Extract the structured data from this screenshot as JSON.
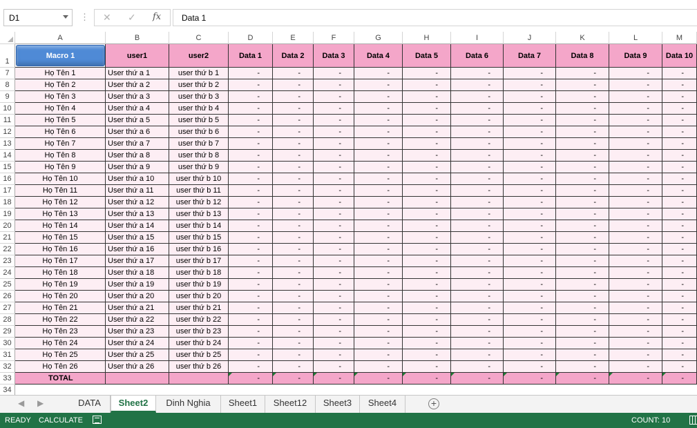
{
  "formula_bar": {
    "name_box": "D1",
    "cancel_symbol": "✕",
    "enter_symbol": "✓",
    "fx_symbol": "fx",
    "content": "Data 1"
  },
  "grid": {
    "column_letters": [
      "A",
      "B",
      "C",
      "D",
      "E",
      "F",
      "G",
      "H",
      "I",
      "J",
      "K",
      "L",
      "M"
    ],
    "header_row_number": "1",
    "headers": [
      "Macro 1",
      "user1",
      "user2",
      "Data 1",
      "Data 2",
      "Data 3",
      "Data 4",
      "Data 5",
      "Data 6",
      "Data 7",
      "Data 8",
      "Data 9",
      "Data 10"
    ],
    "rows": [
      {
        "num": "7",
        "name": "Họ Tên 1",
        "user1": "User thứ a 1",
        "user2": "user thứ b 1"
      },
      {
        "num": "8",
        "name": "Họ Tên 2",
        "user1": "User thứ a 2",
        "user2": "user thứ b 2"
      },
      {
        "num": "9",
        "name": "Họ Tên 3",
        "user1": "User thứ a 3",
        "user2": "user thứ b 3"
      },
      {
        "num": "10",
        "name": "Họ Tên 4",
        "user1": "User thứ a 4",
        "user2": "user thứ b 4"
      },
      {
        "num": "11",
        "name": "Họ Tên 5",
        "user1": "User thứ a 5",
        "user2": "user thứ b 5"
      },
      {
        "num": "12",
        "name": "Họ Tên 6",
        "user1": "User thứ a 6",
        "user2": "user thứ b 6"
      },
      {
        "num": "13",
        "name": "Họ Tên 7",
        "user1": "User thứ a 7",
        "user2": "user thứ b 7"
      },
      {
        "num": "14",
        "name": "Họ Tên 8",
        "user1": "User thứ a 8",
        "user2": "user thứ b 8"
      },
      {
        "num": "15",
        "name": "Họ Tên 9",
        "user1": "User thứ a 9",
        "user2": "user thứ b 9"
      },
      {
        "num": "16",
        "name": "Họ Tên 10",
        "user1": "User thứ a 10",
        "user2": "user thứ b 10"
      },
      {
        "num": "17",
        "name": "Họ Tên 11",
        "user1": "User thứ a 11",
        "user2": "user thứ b 11"
      },
      {
        "num": "18",
        "name": "Họ Tên 12",
        "user1": "User thứ a 12",
        "user2": "user thứ b 12"
      },
      {
        "num": "19",
        "name": "Họ Tên 13",
        "user1": "User thứ a 13",
        "user2": "user thứ b 13"
      },
      {
        "num": "20",
        "name": "Họ Tên 14",
        "user1": "User thứ a 14",
        "user2": "user thứ b 14"
      },
      {
        "num": "21",
        "name": "Họ Tên 15",
        "user1": "User thứ a 15",
        "user2": "user thứ b 15"
      },
      {
        "num": "22",
        "name": "Họ Tên 16",
        "user1": "User thứ a 16",
        "user2": "user thứ b 16"
      },
      {
        "num": "23",
        "name": "Họ Tên 17",
        "user1": "User thứ a 17",
        "user2": "user thứ b 17"
      },
      {
        "num": "24",
        "name": "Họ Tên 18",
        "user1": "User thứ a 18",
        "user2": "user thứ b 18"
      },
      {
        "num": "25",
        "name": "Họ Tên 19",
        "user1": "User thứ a 19",
        "user2": "user thứ b 19"
      },
      {
        "num": "26",
        "name": "Họ Tên 20",
        "user1": "User thứ a 20",
        "user2": "user thứ b 20"
      },
      {
        "num": "27",
        "name": "Họ Tên 21",
        "user1": "User thứ a 21",
        "user2": "user thứ b 21"
      },
      {
        "num": "28",
        "name": "Họ Tên 22",
        "user1": "User thứ a 22",
        "user2": "user thứ b 22"
      },
      {
        "num": "29",
        "name": "Họ Tên 23",
        "user1": "User thứ a 23",
        "user2": "user thứ b 23"
      },
      {
        "num": "30",
        "name": "Họ Tên 24",
        "user1": "User thứ a 24",
        "user2": "user thứ b 24"
      },
      {
        "num": "31",
        "name": "Họ Tên 25",
        "user1": "User thứ a 25",
        "user2": "user thứ b 25"
      },
      {
        "num": "32",
        "name": "Họ Tên 26",
        "user1": "User thứ a 26",
        "user2": "user thứ b 26"
      }
    ],
    "data_placeholder": "-",
    "total_row": {
      "num": "33",
      "label": "TOTAL",
      "value": "-"
    },
    "empty_row_number": "34"
  },
  "sheet_tabs": {
    "prev_icon": "◀",
    "next_icon": "▶",
    "tabs": [
      "DATA",
      "Sheet2",
      "Dinh Nghia",
      "Sheet1",
      "Sheet12",
      "Sheet3",
      "Sheet4"
    ],
    "active": "Sheet2",
    "add_symbol": "+"
  },
  "status_bar": {
    "mode": "READY",
    "calculate": "CALCULATE",
    "count": "COUNT: 10"
  },
  "colors": {
    "header_pink": "#f4a6c9",
    "row_pink": "#fdeef4",
    "macro_blue": "#4f8ad6",
    "excel_green": "#217346"
  }
}
